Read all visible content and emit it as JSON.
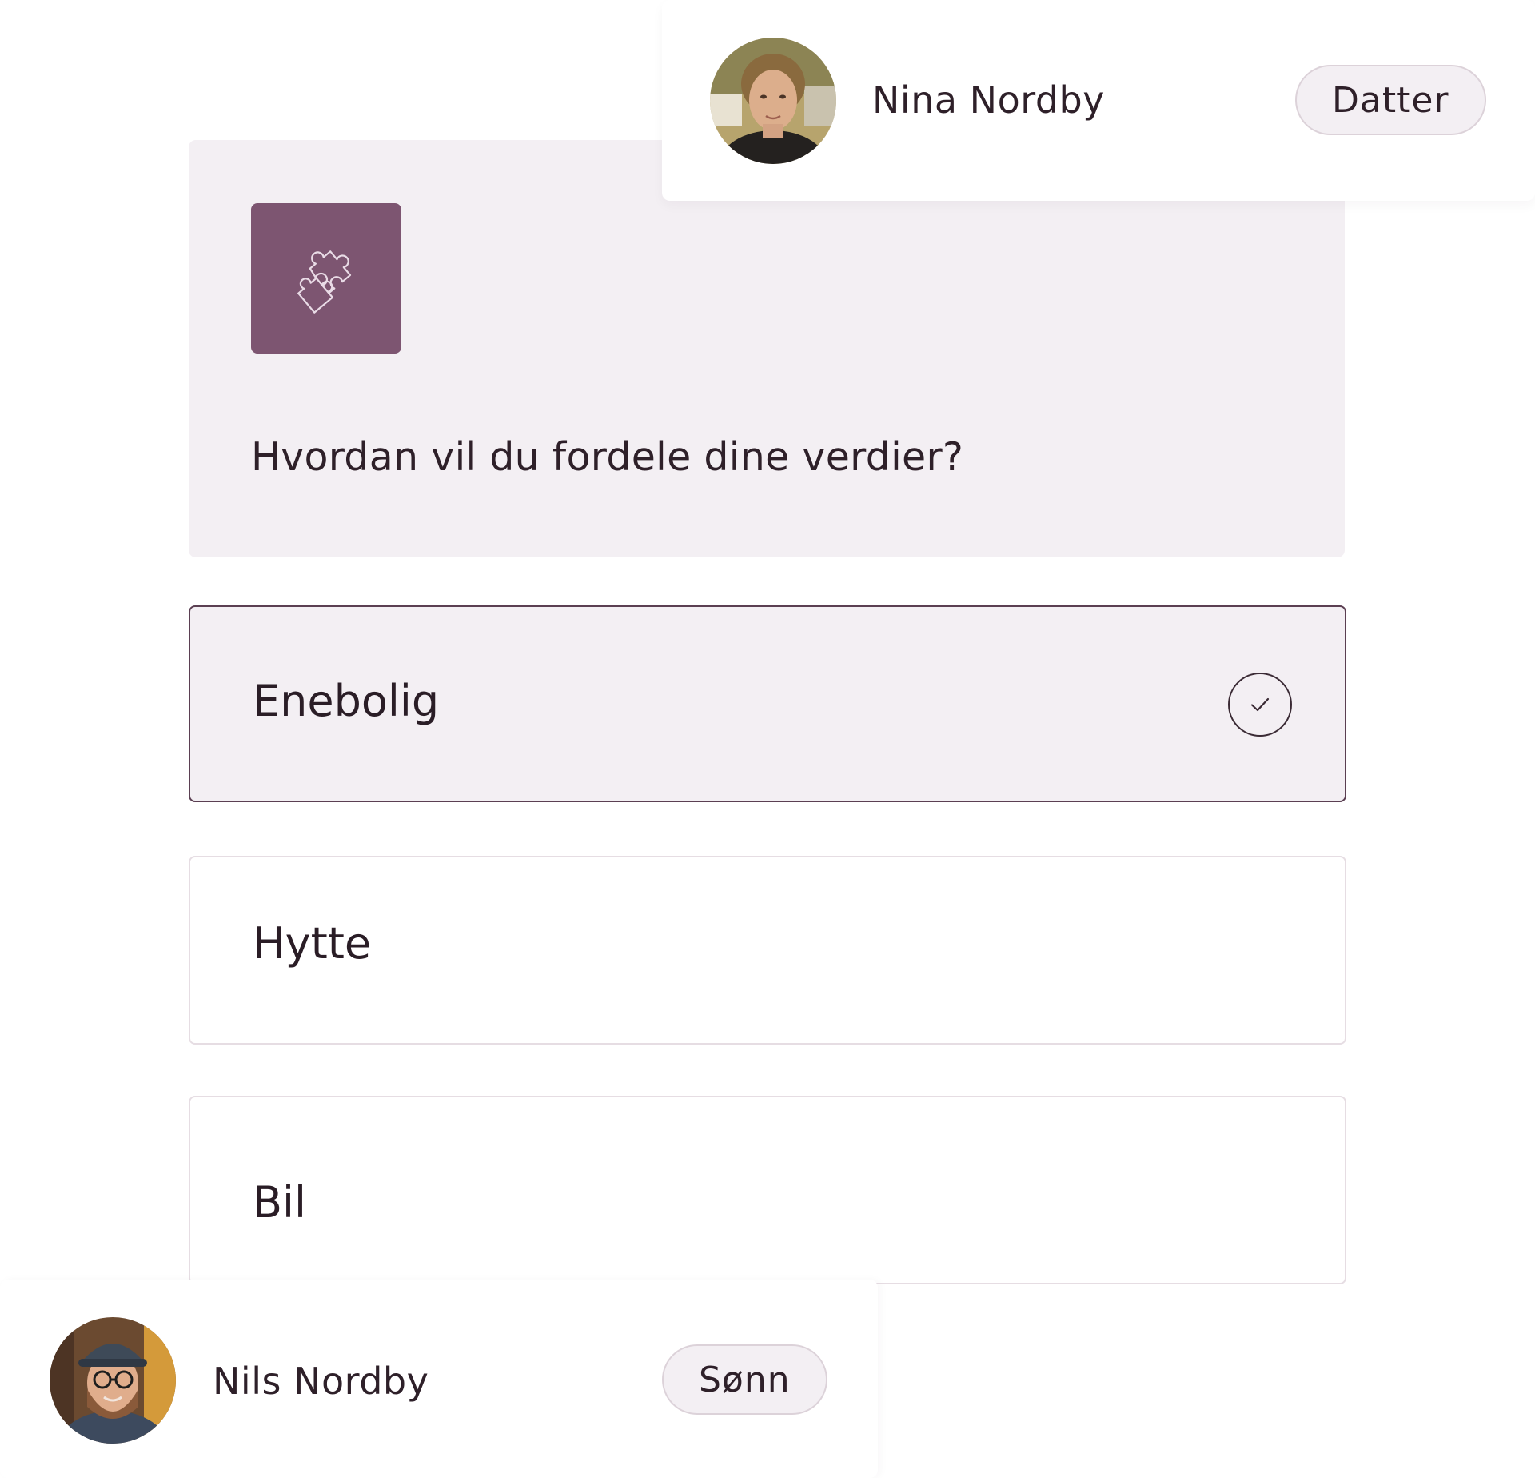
{
  "question": {
    "icon": "puzzle-icon",
    "text": "Hvordan vil du fordele dine verdier?"
  },
  "options": [
    {
      "label": "Enebolig",
      "selected": true,
      "check_icon": "checkmark-icon"
    },
    {
      "label": "Hytte",
      "selected": false
    },
    {
      "label": "Bil",
      "selected": false
    }
  ],
  "people": {
    "top": {
      "name": "Nina Nordby",
      "role": "Datter"
    },
    "bottom": {
      "name": "Nils Nordby",
      "role": "Sønn"
    }
  },
  "colors": {
    "accent": "#7d5571",
    "card_background": "#f3eff3",
    "selected_border": "#5b3f52",
    "text": "#2e2029"
  }
}
